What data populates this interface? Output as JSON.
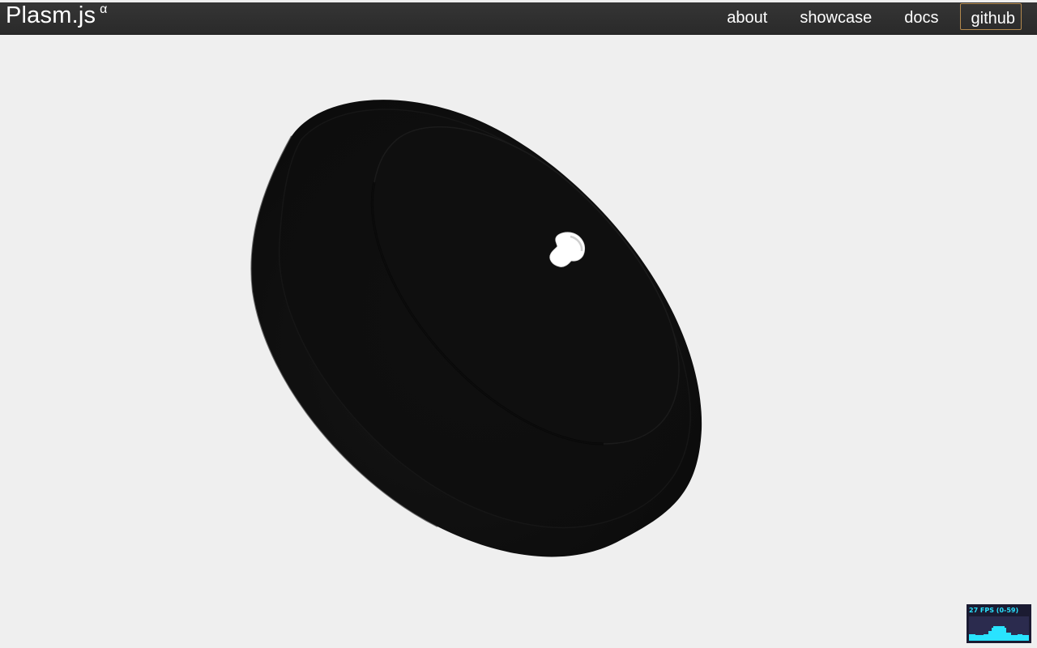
{
  "brand": {
    "name": "Plasm.js",
    "badge": "α"
  },
  "nav": {
    "items": [
      {
        "label": "about"
      },
      {
        "label": "showcase"
      },
      {
        "label": "docs"
      },
      {
        "label": "github"
      }
    ]
  },
  "viewport": {
    "background": "#efefef",
    "model_color": "#111111",
    "shaft_color": "#ffffff"
  },
  "stats": {
    "text": "27 FPS (0-59)",
    "fps": 27,
    "fps_min": 0,
    "fps_max": 59,
    "fg_color": "#29e3ff",
    "bg_color": "#1b1b32"
  },
  "colors": {
    "topbar": "#2f2f2f",
    "github_border": "#b3894e"
  }
}
